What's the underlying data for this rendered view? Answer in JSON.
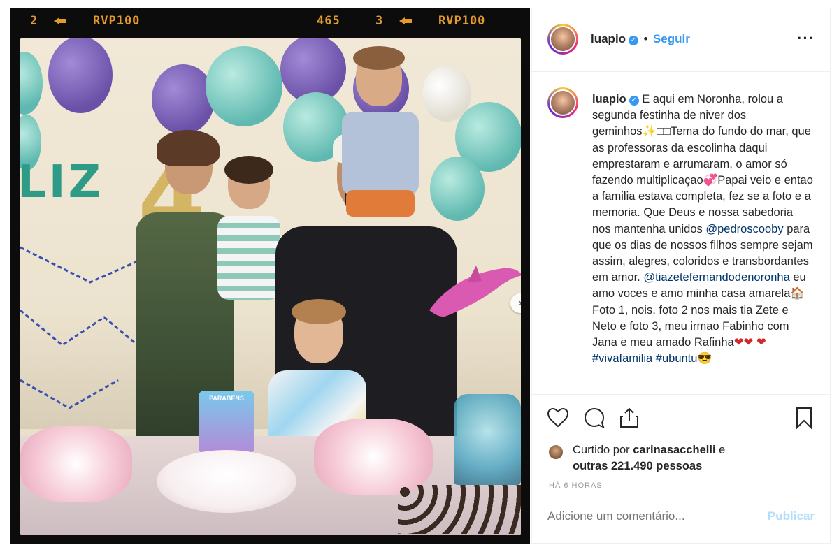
{
  "film": {
    "label_1": "2",
    "label_2": "RVP100",
    "label_3": "465",
    "label_4": "3",
    "label_5": "RVP100"
  },
  "photo": {
    "banner_text": "LIZ",
    "gold_number": "4",
    "topper_text": "PARABÉNS"
  },
  "post": {
    "username": "luapio",
    "follow_label": "Seguir",
    "separator": "•",
    "more_label": "···"
  },
  "caption": {
    "username": "luapio",
    "part1": "E aqui em Noronha, rolou a segunda festinha de niver dos geminhos✨□□Tema do fundo do mar, que as professoras da escolinha daqui emprestaram e arrumaram, o amor só fazendo multiplicaçao💞Papai veio e entao a familia estava completa, fez se a foto e a memoria. Que Deus e nossa sabedoria nos mantenha unidos ",
    "mention1": "@pedroscooby",
    "part2": " para que os dias de nossos filhos sempre sejam assim, alegres, coloridos e transbordantes em amor. ",
    "mention2": "@tiazetefernandodenoronha",
    "part3": " eu amo voces e amo minha casa amarela🏠 Foto 1, nois, foto 2 nos mais tia Zete e Neto e foto 3, meu irmao Fabinho com Jana e meu amado Rafinha",
    "hearts": "❤❤ ❤",
    "hashtag1": "#vivafamilia",
    "hashtag2": "#ubuntu",
    "end_emoji": "😎"
  },
  "likes": {
    "prefix": "Curtido por",
    "user": "carinasacchelli",
    "conjunction": "e",
    "others": "outras 221.490 pessoas"
  },
  "timestamp": "HÁ 6 HORAS",
  "comment": {
    "placeholder": "Adicione um comentário...",
    "publish_label": "Publicar"
  },
  "icons": {
    "like": "heart-icon",
    "comment": "comment-icon",
    "share": "share-icon",
    "save": "bookmark-icon",
    "next": "chevron-right-icon"
  },
  "colors": {
    "accent": "#3897f0",
    "film_text": "#e49a2a",
    "publish_disabled": "#b2dffc",
    "mention": "#003569"
  }
}
